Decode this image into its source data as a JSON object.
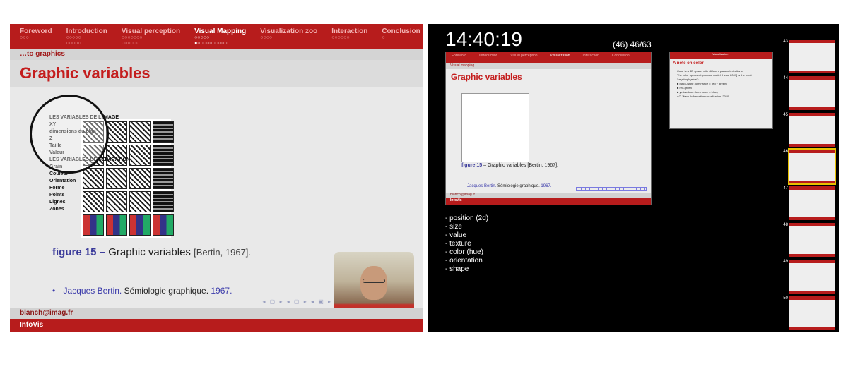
{
  "left_slide": {
    "nav_sections": [
      {
        "label": "Foreword",
        "dots": "○○○",
        "active": false
      },
      {
        "label": "Introduction",
        "dots": "○○○○○\n○○○○○",
        "active": false
      },
      {
        "label": "Visual perception",
        "dots": "○○○○○○○\n○○○○○○",
        "active": false
      },
      {
        "label": "Visual Mapping",
        "dots": "○○○○○\n●○○○○○○○○○○",
        "active": true
      },
      {
        "label": "Visualization zoo",
        "dots": "○○○○",
        "active": false
      },
      {
        "label": "Interaction",
        "dots": "○○○○○○",
        "active": false
      },
      {
        "label": "Conclusion",
        "dots": "○",
        "active": false
      }
    ],
    "subtitle": "…to graphics",
    "title": "Graphic variables",
    "figure_labels": [
      "LES VARIABLES DE L'IMAGE",
      "XY",
      "dimensions du plan",
      "Z",
      "Taille",
      "Valeur",
      "LES VARIABLES DE SÉPARATION",
      "Grain",
      "Couleur",
      "Orientation",
      "Forme",
      "Points",
      "Lignes",
      "Zones"
    ],
    "caption_label": "figure 15 –",
    "caption_text": "Graphic variables",
    "caption_ref": "[Bertin, 1967].",
    "bullet_author": "Jacques Bertin.",
    "bullet_title": "Sémiologie graphique.",
    "bullet_year": "1967.",
    "nav_symbols": "◂ ▢ ▸ ◂ ▢ ▸ ◂ ▣ ▸",
    "footer_email": "blanch@imag.fr",
    "footer_brand": "InfoVis"
  },
  "presenter": {
    "clock": "14:40:19",
    "counter": "(46) 46/63",
    "current": {
      "nav": [
        "Foreword",
        "Introduction",
        "Visual perception",
        "Visualization",
        "Interaction",
        "Conclusion"
      ],
      "subtitle": "Visual mapping",
      "title": "Graphic variables",
      "caption_label": "figure 15",
      "caption_text": "– Graphic variables [Bertin, 1967].",
      "bullet_author": "Jacques Bertin.",
      "bullet_title": "Sémiologie graphique.",
      "bullet_year": "1967.",
      "footer_email": "blanch@imag.fr",
      "footer_brand": "InfoVis"
    },
    "next": {
      "header": "Visualization",
      "title": "A note on color",
      "lines": [
        "Color is a 3D space, with different parameterizations.",
        "The color opponent process model [Hess, 2009] is the most",
        "“psychophysical”:",
        "■ black-white (luminance = red + green)",
        "■ red-green",
        "■ yellow-blue (luminance – blue)",
        "• C. Ware. Information visualization. 2010."
      ]
    },
    "notes": [
      "- position (2d)",
      "- size",
      "- value",
      "- texture",
      "- color (hue)",
      "- orientation",
      "- shape"
    ],
    "thumbnails": [
      {
        "num": "43",
        "selected": false
      },
      {
        "num": "44",
        "selected": false
      },
      {
        "num": "45",
        "selected": false
      },
      {
        "num": "46",
        "selected": true
      },
      {
        "num": "47",
        "selected": false
      },
      {
        "num": "48",
        "selected": false
      },
      {
        "num": "49",
        "selected": false
      },
      {
        "num": "50",
        "selected": false
      }
    ]
  }
}
